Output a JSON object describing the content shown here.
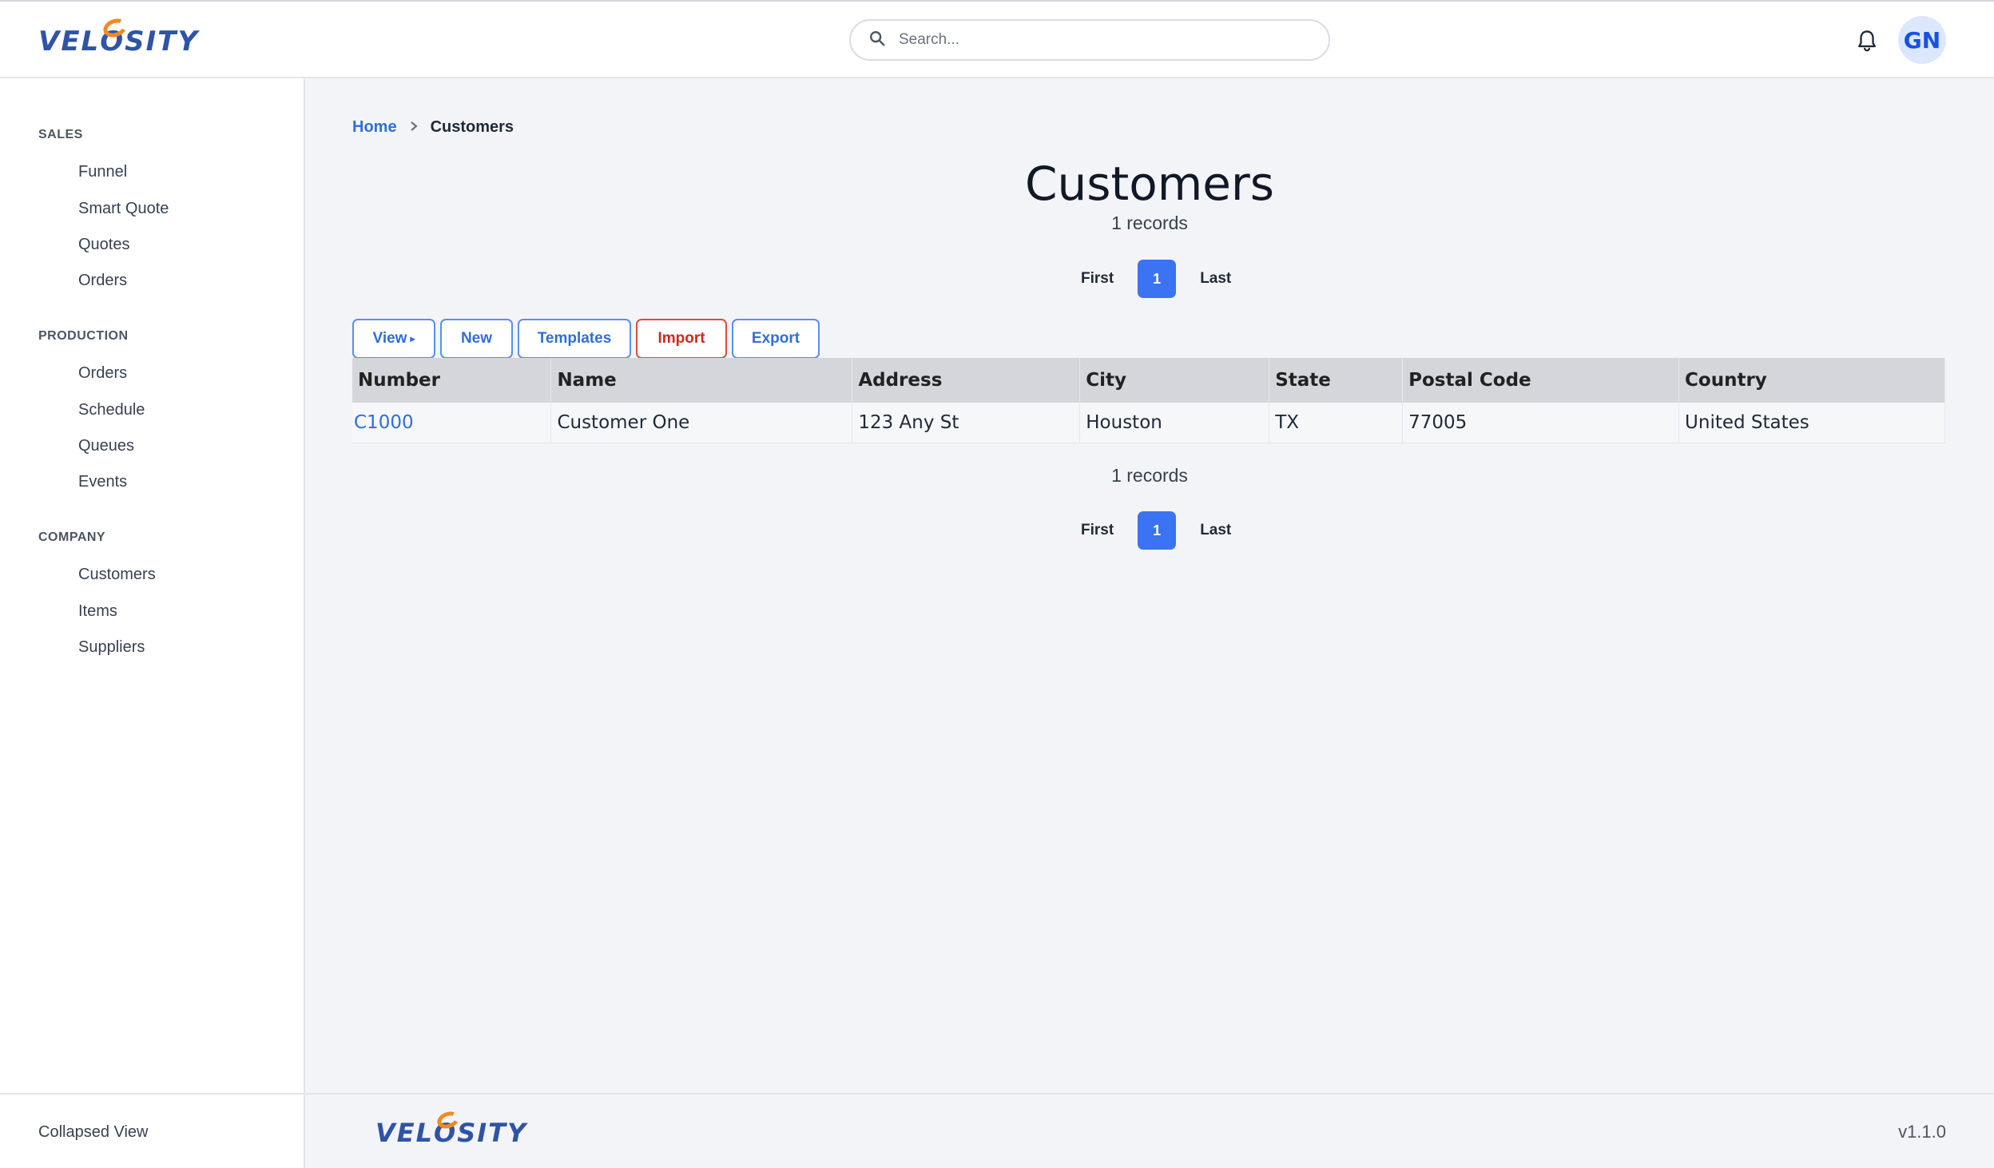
{
  "app": {
    "logo_text_left": "VEL",
    "logo_text_o": "O",
    "logo_text_right": "SITY",
    "version": "v1.1.0"
  },
  "header": {
    "search_placeholder": "Search...",
    "avatar_initials": "GN"
  },
  "sidebar": {
    "sections": [
      {
        "title": "SALES",
        "items": [
          "Funnel",
          "Smart Quote",
          "Quotes",
          "Orders"
        ]
      },
      {
        "title": "PRODUCTION",
        "items": [
          "Orders",
          "Schedule",
          "Queues",
          "Events"
        ]
      },
      {
        "title": "COMPANY",
        "items": [
          "Customers",
          "Items",
          "Suppliers"
        ]
      }
    ],
    "collapsed_view_label": "Collapsed View"
  },
  "breadcrumb": {
    "home": "Home",
    "current": "Customers"
  },
  "page": {
    "title": "Customers",
    "records_top": "1 records",
    "records_bottom": "1 records"
  },
  "pager": {
    "first": "First",
    "current": "1",
    "last": "Last"
  },
  "toolbar": {
    "view": "View",
    "new": "New",
    "templates": "Templates",
    "import": "Import",
    "export": "Export"
  },
  "table": {
    "columns": [
      "Number",
      "Name",
      "Address",
      "City",
      "State",
      "Postal Code",
      "Country"
    ],
    "rows": [
      [
        "C1000",
        "Customer One",
        "123 Any St",
        "Houston",
        "TX",
        "77005",
        "United States"
      ]
    ]
  },
  "colors": {
    "accent": "#3b74f2",
    "link": "#2f6fd6",
    "danger": "#d0281b",
    "logo_blue": "#2f54a6",
    "logo_orange": "#f08a24"
  }
}
